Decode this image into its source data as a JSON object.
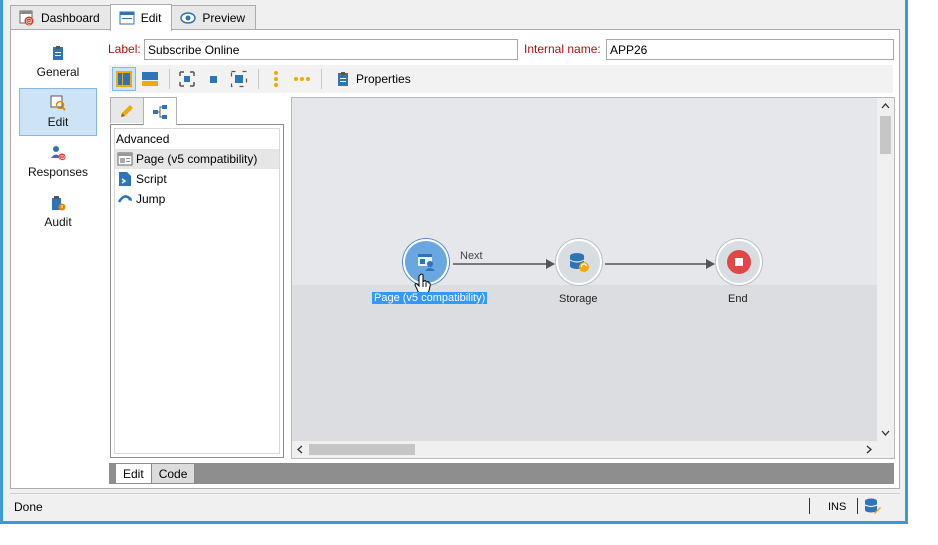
{
  "tabs": [
    {
      "label": "Dashboard",
      "icon": "dashboard-icon",
      "active": false
    },
    {
      "label": "Edit",
      "icon": "edit-form-icon",
      "active": true
    },
    {
      "label": "Preview",
      "icon": "eye-icon",
      "active": false
    }
  ],
  "sidebar": {
    "items": [
      {
        "label": "General",
        "icon": "clipboard-icon"
      },
      {
        "label": "Edit",
        "icon": "edit-search-icon",
        "active": true
      },
      {
        "label": "Responses",
        "icon": "user-at-icon"
      },
      {
        "label": "Audit",
        "icon": "audit-icon"
      }
    ]
  },
  "form": {
    "label_caption": "Label:",
    "label_value": "Subscribe Online",
    "internal_caption": "Internal name:",
    "internal_value": "APP26"
  },
  "toolbar": {
    "properties_label": "Properties"
  },
  "palette": {
    "header": "Advanced",
    "items": [
      {
        "label": "Page (v5 compatibility)",
        "icon": "page-icon"
      },
      {
        "label": "Script",
        "icon": "script-icon"
      },
      {
        "label": "Jump",
        "icon": "jump-icon"
      }
    ]
  },
  "workflow": {
    "transition_label": "Next",
    "nodes": [
      {
        "label": "Page (v5 compatibility)",
        "icon": "page-node-icon",
        "selected": true
      },
      {
        "label": "Storage",
        "icon": "database-icon"
      },
      {
        "label": "End",
        "icon": "stop-icon"
      }
    ]
  },
  "bottom_tabs": [
    {
      "label": "Edit",
      "active": true
    },
    {
      "label": "Code",
      "active": false
    }
  ],
  "status": {
    "text": "Done",
    "mode": "INS"
  },
  "colors": {
    "accent": "#3a9ad9",
    "label_red": "#b01010",
    "selection": "#3399ff",
    "active_bg": "#cde4f7"
  }
}
